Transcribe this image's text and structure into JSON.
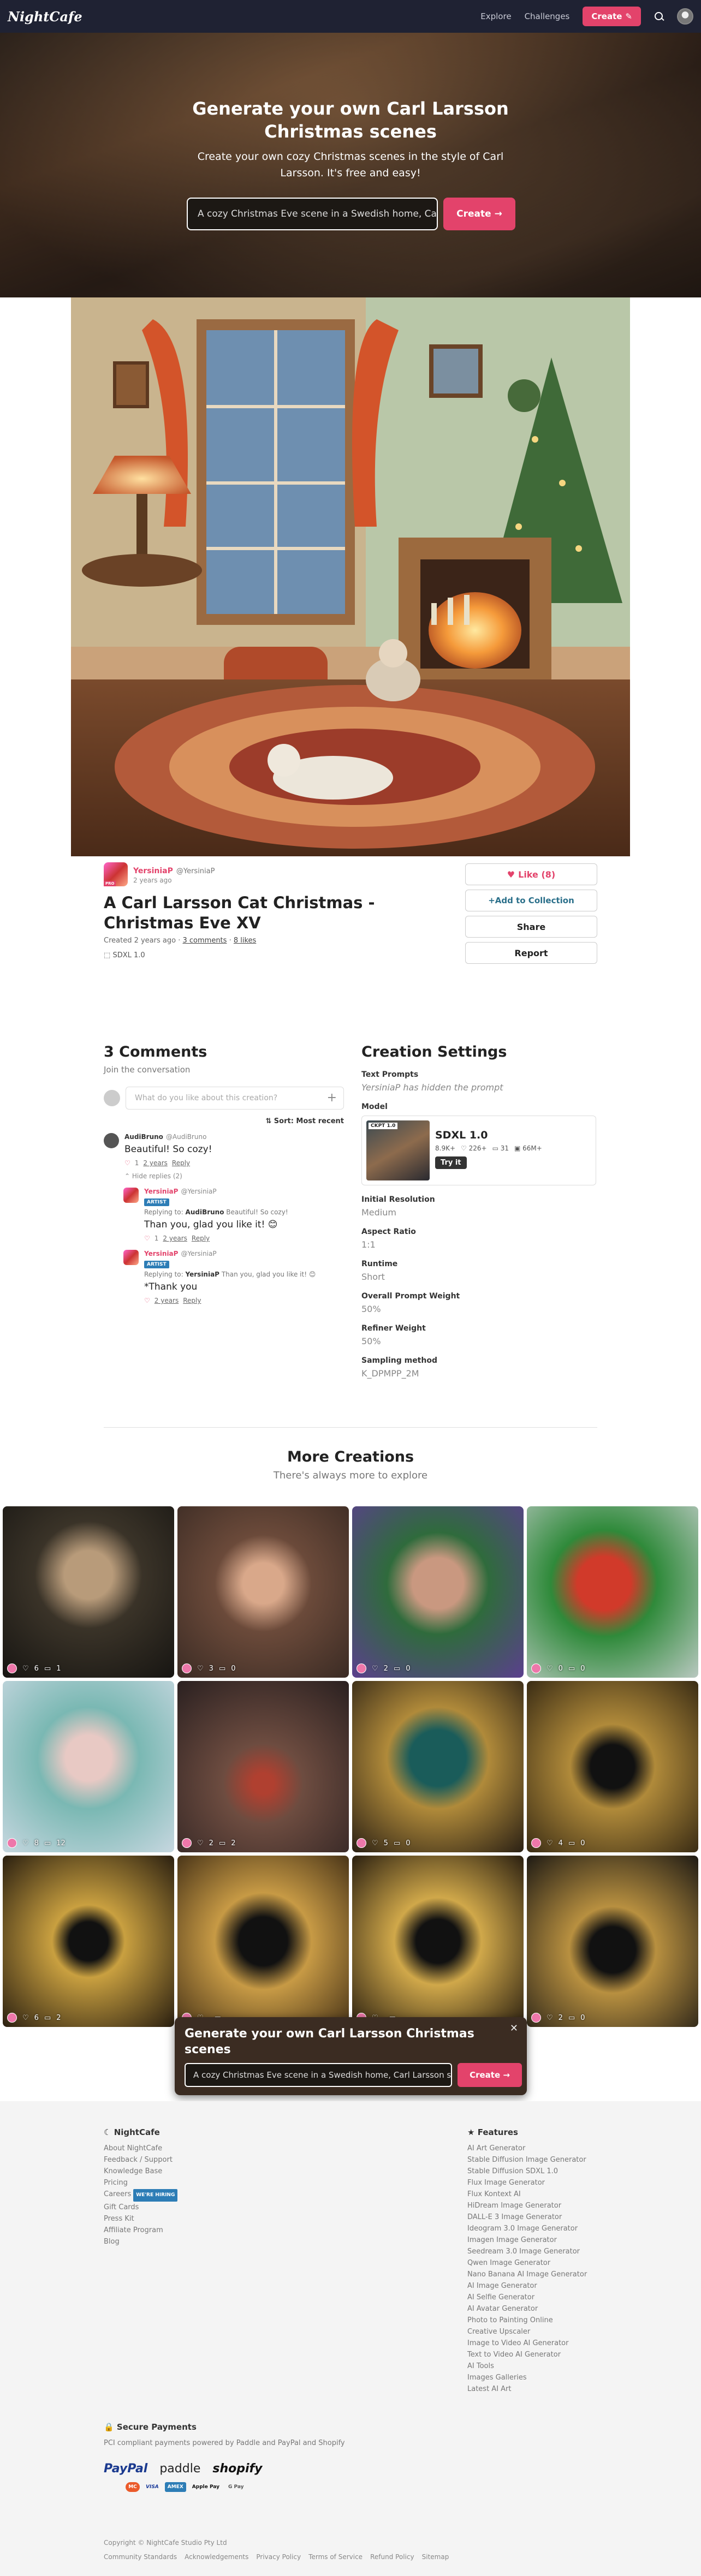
{
  "nav": {
    "logo": "NightCafe",
    "links": [
      "Explore",
      "Challenges"
    ],
    "create_label": "Create"
  },
  "hero": {
    "title": "Generate your own Carl Larsson Christmas scenes",
    "subtitle": "Create your own cozy Christmas scenes in the style of Carl Larsson. It's free and easy!",
    "input_value": "A cozy Christmas Eve scene in a Swedish home, Carl Larsson style",
    "button": "Create →"
  },
  "creation": {
    "creator_name": "YersiniaP",
    "creator_handle": "@YersiniaP",
    "creator_badge": "PRO",
    "age": "2 years ago",
    "title": "A Carl Larsson Cat Christmas - Christmas Eve XV",
    "created_prefix": "Created 2 years ago",
    "comments_link": "3 comments",
    "likes_link": "8 likes",
    "model": "SDXL 1.0"
  },
  "actions": {
    "like": "Like (8)",
    "collection": "+Add to Collection",
    "share": "Share",
    "report": "Report"
  },
  "comments": {
    "heading": "3 Comments",
    "join": "Join the conversation",
    "placeholder": "What do you like about this creation?",
    "sort": "Sort: Most recent",
    "items": [
      {
        "name": "AudiBruno",
        "handle": "@AudiBruno",
        "text": "Beautiful! So cozy!",
        "likes": "1",
        "age": "2 years",
        "reply": "Reply",
        "hide": "Hide replies (2)"
      },
      {
        "name": "YersiniaP",
        "handle": "@YersiniaP",
        "badge": "ARTIST",
        "replying_prefix": "Replying to:",
        "replying_user": "AudiBruno",
        "replying_text": "Beautiful! So cozy!",
        "text": "Than you, glad you like it! 😊",
        "likes": "1",
        "age": "2 years",
        "reply": "Reply"
      },
      {
        "name": "YersiniaP",
        "handle": "@YersiniaP",
        "badge": "ARTIST",
        "replying_prefix": "Replying to:",
        "replying_user": "YersiniaP",
        "replying_text": "Than you, glad you like it! 😊",
        "text": "*Thank you",
        "age": "2 years",
        "reply": "Reply"
      }
    ]
  },
  "settings": {
    "heading": "Creation Settings",
    "prompts_label": "Text Prompts",
    "prompts_value": "YersiniaP has hidden the prompt",
    "model_label": "Model",
    "model_thumb_tag": "CKPT 1.0",
    "model_name": "SDXL 1.0",
    "model_stats": [
      "8.9K+",
      "226+",
      "31",
      "66M+"
    ],
    "try_it": "Try it",
    "rows": [
      {
        "label": "Initial Resolution",
        "value": "Medium"
      },
      {
        "label": "Aspect Ratio",
        "value": "1:1"
      },
      {
        "label": "Runtime",
        "value": "Short"
      },
      {
        "label": "Overall Prompt Weight",
        "value": "50%"
      },
      {
        "label": "Refiner Weight",
        "value": "50%"
      },
      {
        "label": "Sampling method",
        "value": "K_DPMPP_2M"
      }
    ]
  },
  "more": {
    "heading": "More Creations",
    "sub": "There's always more to explore",
    "tiles": [
      {
        "likes": "6",
        "comments": "1",
        "bg": "radial-gradient(circle at 50% 40%,#b89b7a 0 18%,#3a3328 40%,#171512 100%)"
      },
      {
        "likes": "3",
        "comments": "0",
        "bg": "radial-gradient(circle at 50% 45%,#d9a88a 0 16%,#6b4a3a 38%,#3b2b24 100%)"
      },
      {
        "likes": "2",
        "comments": "0",
        "bg": "radial-gradient(circle at 50% 45%,#c99880 0 20%,#2f6b3c 40%,#5b3f8e 100%)"
      },
      {
        "likes": "0",
        "comments": "0",
        "bg": "radial-gradient(circle at 45% 45%,#d13a2a 0 20%,#2f8a3a 40%,#b9c8c0 100%)"
      },
      {
        "likes": "8",
        "comments": "12",
        "bg": "radial-gradient(circle at 50% 45%,#e8c9c4 0 18%,#7ab8b3 40%,#c7d7e0 100%)"
      },
      {
        "likes": "2",
        "comments": "2",
        "bg": "radial-gradient(circle at 50% 60%,#b04030 0 8%,#6d4c40 30%,#2a2020 100%)"
      },
      {
        "likes": "5",
        "comments": "0",
        "bg": "radial-gradient(circle at 50% 45%,#1a5c5a 0 22%,#b08a3a 40%,#2a2014 100%)"
      },
      {
        "likes": "4",
        "comments": "0",
        "bg": "radial-gradient(circle at 50% 50%,#111 0 18%,#b08a3a 35%,#3a2c14 100%)"
      },
      {
        "likes": "6",
        "comments": "2",
        "bg": "radial-gradient(circle at 50% 50%,#111 0 16%,#c9a040 30%,#2a1f10 100%)"
      },
      {
        "likes": "",
        "comments": "",
        "bg": "radial-gradient(circle at 50% 50%,#111 0 20%,#c79a45 40%,#4a3518 100%)"
      },
      {
        "likes": "",
        "comments": "",
        "bg": "radial-gradient(circle at 50% 50%,#111 0 18%,#d0a84a 36%,#2a1f10 100%)"
      },
      {
        "likes": "2",
        "comments": "0",
        "bg": "radial-gradient(circle at 50% 55%,#111 0 18%,#b89040 34%,#1e1a14 100%)"
      }
    ]
  },
  "popup": {
    "title": "Generate your own Carl Larsson Christmas scenes",
    "input_value": "A cozy Christmas Eve scene in a Swedish home, Carl Larsson style",
    "button": "Create →"
  },
  "footer": {
    "nightcafe_head": "NightCafe",
    "nightcafe_links": [
      "About NightCafe",
      "Feedback / Support",
      "Knowledge Base",
      "Pricing",
      "Careers",
      "Gift Cards",
      "Press Kit",
      "Affiliate Program",
      "Blog"
    ],
    "hiring": "WE'RE HIRING",
    "features_head": "Features",
    "features_links": [
      "AI Art Generator",
      "Stable Diffusion Image Generator",
      "Stable Diffusion SDXL 1.0",
      "Flux Image Generator",
      "Flux Kontext AI",
      "HiDream Image Generator",
      "DALL-E 3 Image Generator",
      "Ideogram 3.0 Image Generator",
      "Imagen Image Generator",
      "Seedream 3.0 Image Generator",
      "Qwen Image Generator",
      "Nano Banana AI Image Generator",
      "AI Image Generator",
      "AI Selfie Generator",
      "AI Avatar Generator",
      "Photo to Painting Online",
      "Creative Upscaler",
      "Image to Video AI Generator",
      "Text to Video AI Generator",
      "AI Tools",
      "Images Galleries",
      "Latest AI Art"
    ],
    "payments_head": "Secure Payments",
    "payments_text": "PCI compliant payments powered by Paddle and PayPal and Shopify",
    "pay_logos": [
      "PayPal",
      "paddle",
      "shopify"
    ],
    "cards": [
      "MC",
      "VISA",
      "AMEX",
      "Apple Pay",
      "G Pay"
    ],
    "copyright": "Copyright © NightCafe Studio Pty Ltd",
    "bottom_links": [
      "Community Standards",
      "Acknowledgements",
      "Privacy Policy",
      "Terms of Service",
      "Refund Policy",
      "Sitemap"
    ]
  }
}
